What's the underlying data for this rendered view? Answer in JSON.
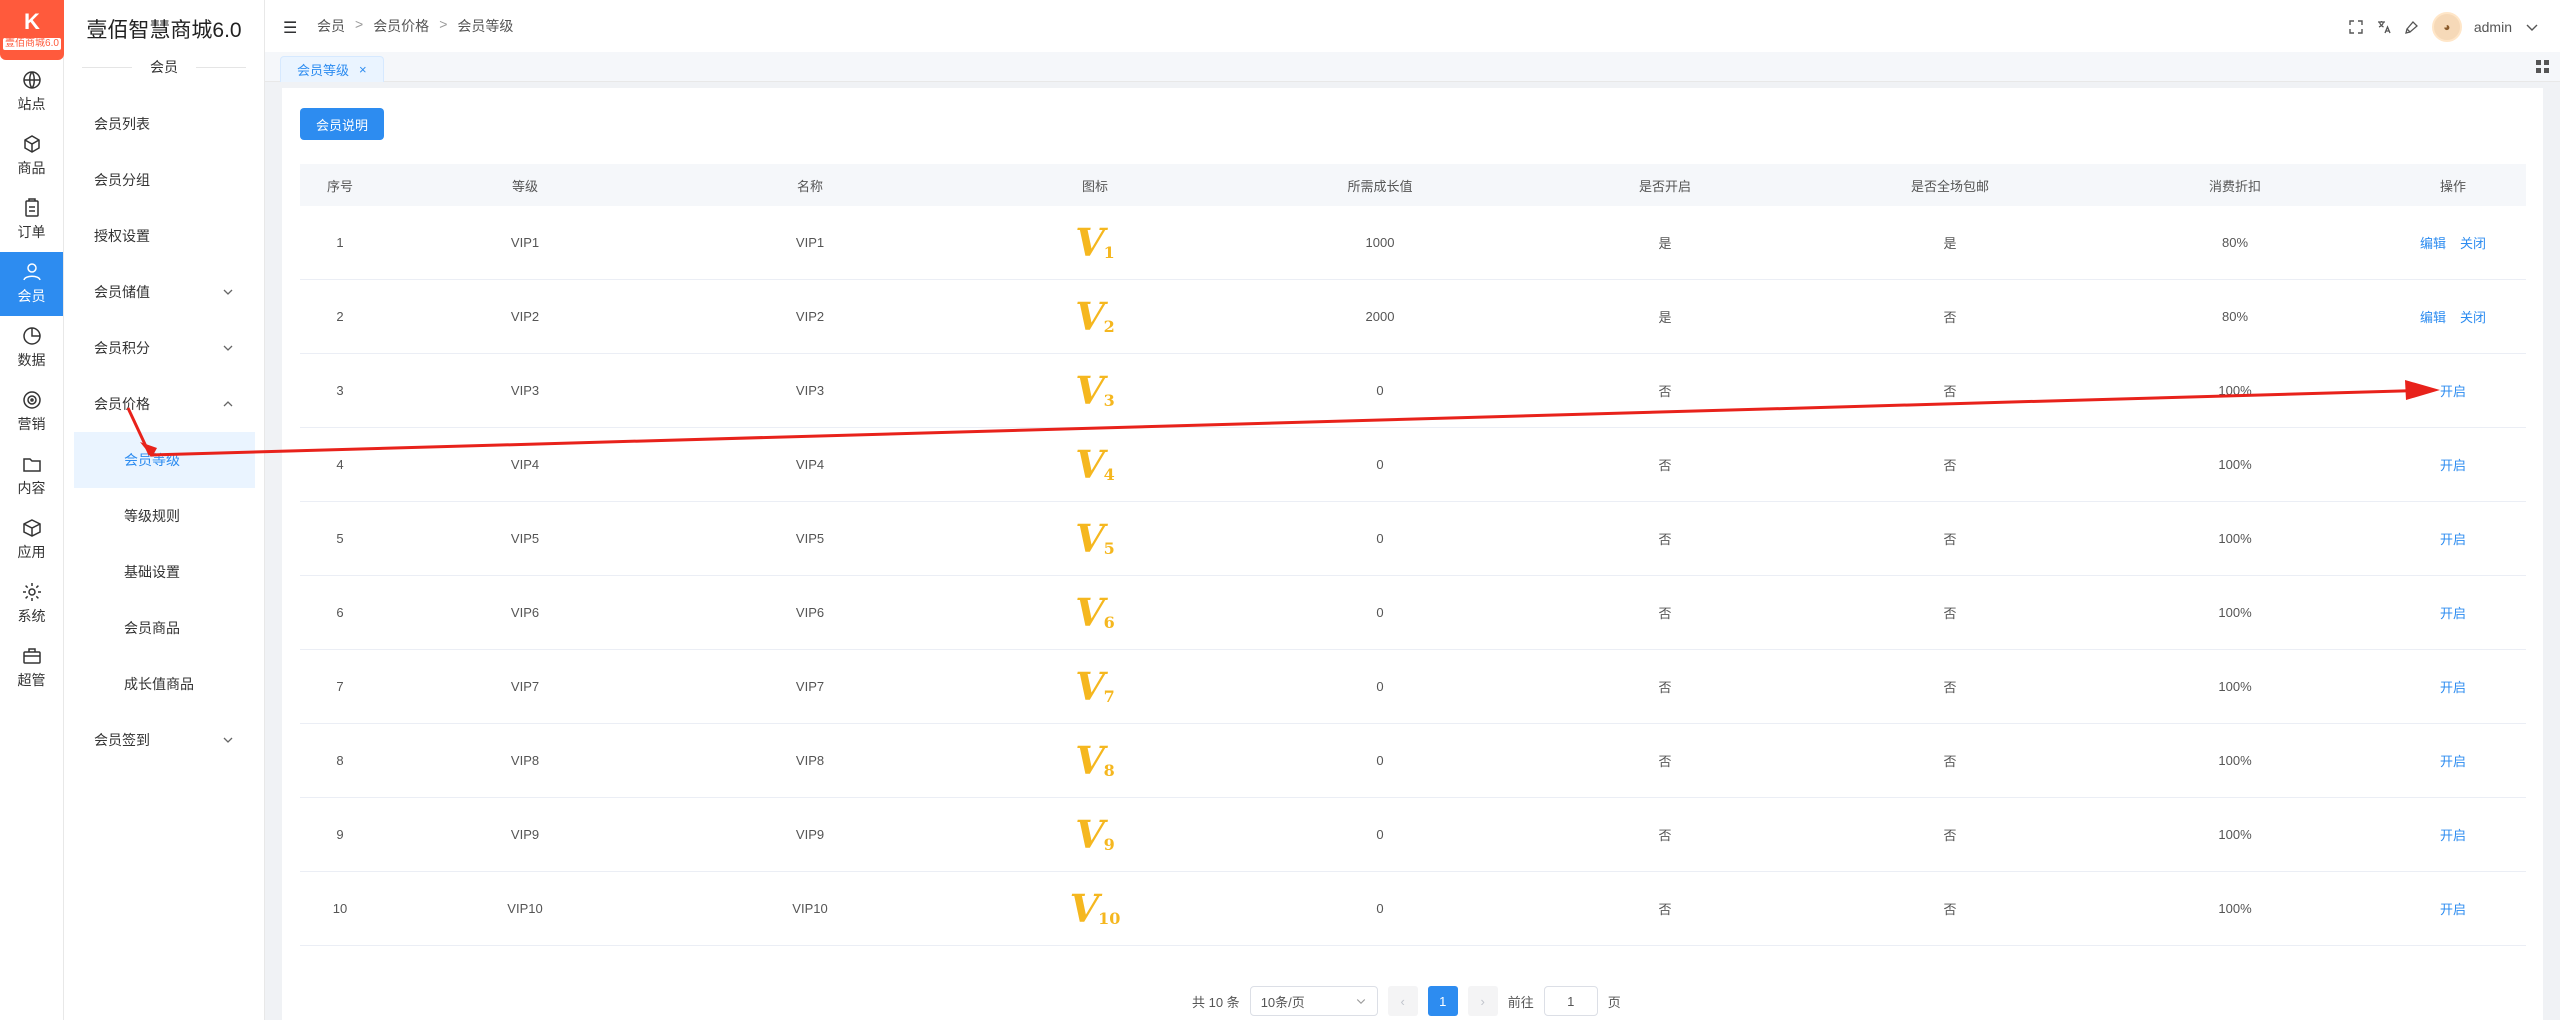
{
  "app": {
    "title": "壹佰智慧商城6.0",
    "logo_mark": "K",
    "logo_sub": "壹佰商城6.0"
  },
  "rail": [
    {
      "label": "站点",
      "icon": "globe-icon"
    },
    {
      "label": "商品",
      "icon": "box-icon"
    },
    {
      "label": "订单",
      "icon": "clipboard-icon"
    },
    {
      "label": "会员",
      "icon": "user-icon",
      "active": true
    },
    {
      "label": "数据",
      "icon": "pie-icon"
    },
    {
      "label": "营销",
      "icon": "target-icon"
    },
    {
      "label": "内容",
      "icon": "folder-icon"
    },
    {
      "label": "应用",
      "icon": "cube-icon"
    },
    {
      "label": "系统",
      "icon": "gear-icon"
    },
    {
      "label": "超管",
      "icon": "briefcase-icon"
    }
  ],
  "sidebar": {
    "section": "会员",
    "items": [
      {
        "label": "会员列表"
      },
      {
        "label": "会员分组"
      },
      {
        "label": "授权设置"
      },
      {
        "label": "会员储值",
        "chevron": "down"
      },
      {
        "label": "会员积分",
        "chevron": "down"
      },
      {
        "label": "会员价格",
        "chevron": "up"
      }
    ],
    "subitems": [
      {
        "label": "会员等级",
        "active": true
      },
      {
        "label": "等级规则"
      },
      {
        "label": "基础设置"
      },
      {
        "label": "会员商品"
      },
      {
        "label": "成长值商品"
      }
    ],
    "after": {
      "label": "会员签到",
      "chevron": "down"
    }
  },
  "header": {
    "breadcrumb": [
      "会员",
      "会员价格",
      "会员等级"
    ],
    "breadcrumb_sep": ">",
    "user": "admin"
  },
  "tabs": [
    {
      "label": "会员等级",
      "close": "×"
    }
  ],
  "toolbar": {
    "explain_label": "会员说明"
  },
  "table": {
    "columns": [
      "序号",
      "等级",
      "名称",
      "图标",
      "所需成长值",
      "是否开启",
      "是否全场包邮",
      "消费折扣",
      "操作"
    ],
    "rows": [
      {
        "no": "1",
        "level": "VIP1",
        "name": "VIP1",
        "icon_num": "1",
        "growth": "1000",
        "enabled": "是",
        "free_ship": "是",
        "discount": "80%",
        "actions": [
          "编辑",
          "关闭"
        ]
      },
      {
        "no": "2",
        "level": "VIP2",
        "name": "VIP2",
        "icon_num": "2",
        "growth": "2000",
        "enabled": "是",
        "free_ship": "否",
        "discount": "80%",
        "actions": [
          "编辑",
          "关闭"
        ]
      },
      {
        "no": "3",
        "level": "VIP3",
        "name": "VIP3",
        "icon_num": "3",
        "growth": "0",
        "enabled": "否",
        "free_ship": "否",
        "discount": "100%",
        "actions": [
          "开启"
        ]
      },
      {
        "no": "4",
        "level": "VIP4",
        "name": "VIP4",
        "icon_num": "4",
        "growth": "0",
        "enabled": "否",
        "free_ship": "否",
        "discount": "100%",
        "actions": [
          "开启"
        ]
      },
      {
        "no": "5",
        "level": "VIP5",
        "name": "VIP5",
        "icon_num": "5",
        "growth": "0",
        "enabled": "否",
        "free_ship": "否",
        "discount": "100%",
        "actions": [
          "开启"
        ]
      },
      {
        "no": "6",
        "level": "VIP6",
        "name": "VIP6",
        "icon_num": "6",
        "growth": "0",
        "enabled": "否",
        "free_ship": "否",
        "discount": "100%",
        "actions": [
          "开启"
        ]
      },
      {
        "no": "7",
        "level": "VIP7",
        "name": "VIP7",
        "icon_num": "7",
        "growth": "0",
        "enabled": "否",
        "free_ship": "否",
        "discount": "100%",
        "actions": [
          "开启"
        ]
      },
      {
        "no": "8",
        "level": "VIP8",
        "name": "VIP8",
        "icon_num": "8",
        "growth": "0",
        "enabled": "否",
        "free_ship": "否",
        "discount": "100%",
        "actions": [
          "开启"
        ]
      },
      {
        "no": "9",
        "level": "VIP9",
        "name": "VIP9",
        "icon_num": "9",
        "growth": "0",
        "enabled": "否",
        "free_ship": "否",
        "discount": "100%",
        "actions": [
          "开启"
        ]
      },
      {
        "no": "10",
        "level": "VIP10",
        "name": "VIP10",
        "icon_num": "10",
        "growth": "0",
        "enabled": "否",
        "free_ship": "否",
        "discount": "100%",
        "actions": [
          "开启"
        ]
      }
    ]
  },
  "pager": {
    "total": "共 10 条",
    "page_size": "10条/页",
    "prev": "‹",
    "current": "1",
    "next": "›",
    "goto_label": "前往",
    "goto_value": "1",
    "goto_unit": "页"
  },
  "colors": {
    "accent": "#2d8cf0",
    "logo": "#ff5a3c",
    "vip_gold": "#f5b71f",
    "annotation_arrow": "#e8221b"
  }
}
